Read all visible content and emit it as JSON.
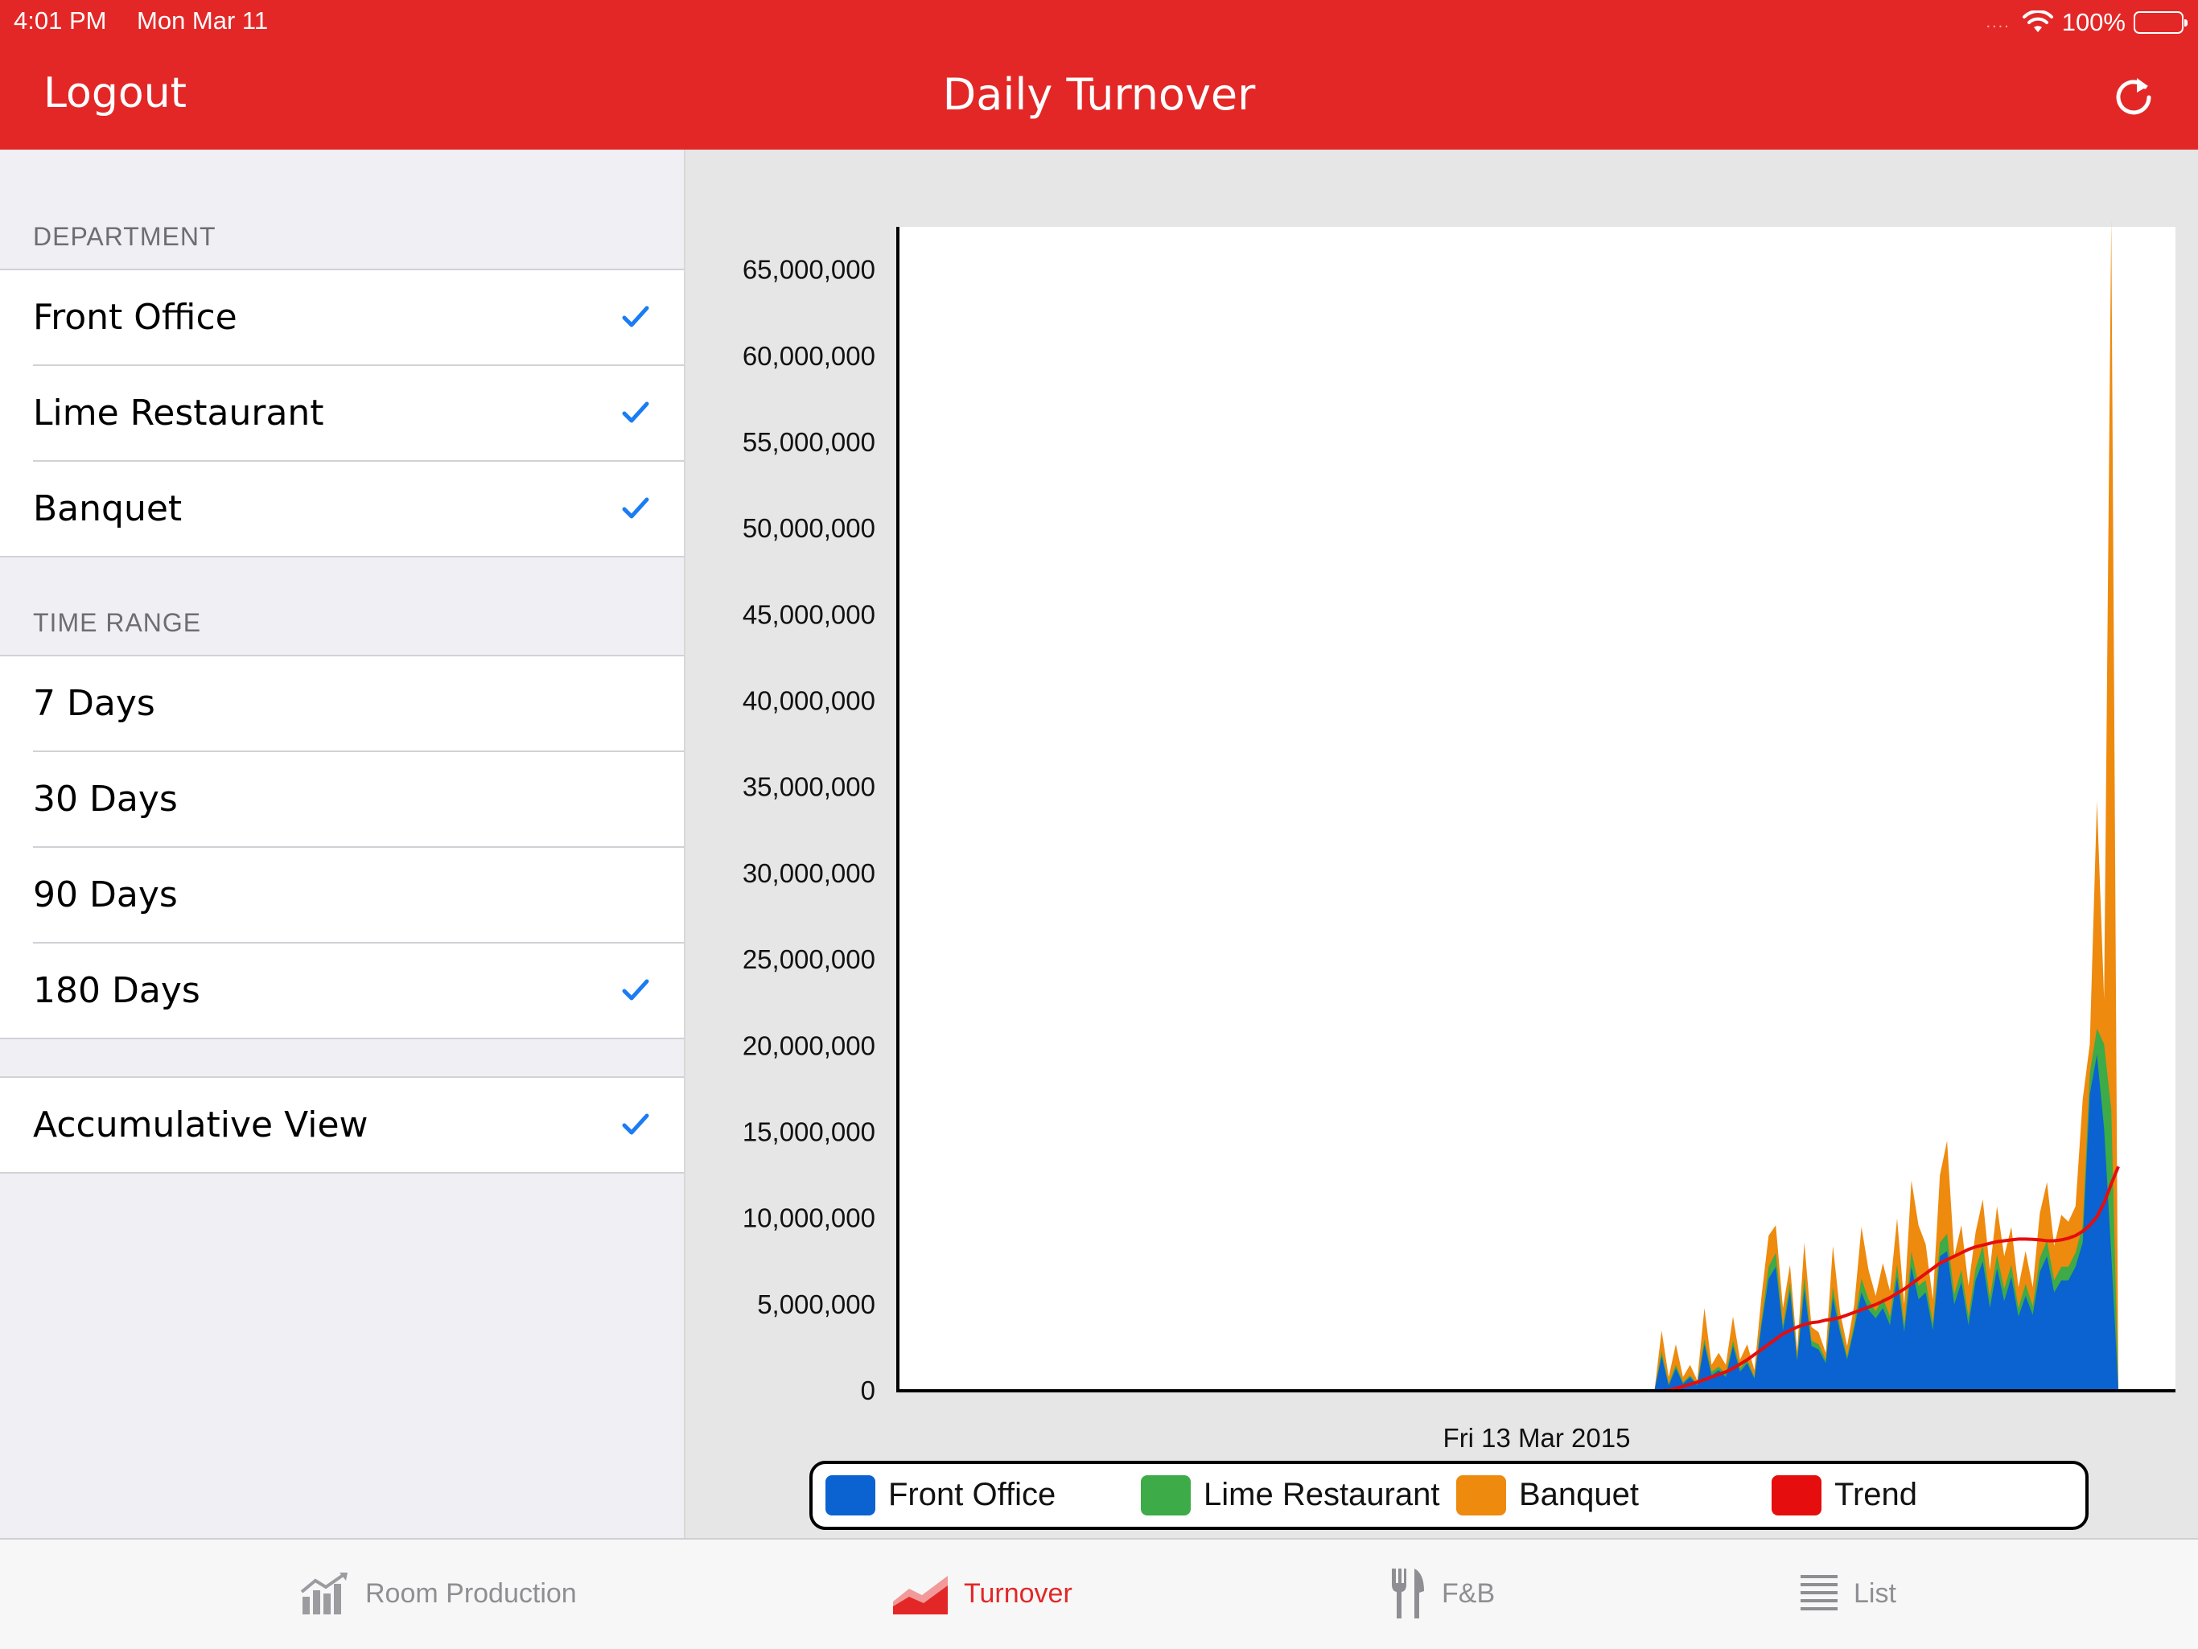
{
  "status_bar": {
    "time": "4:01 PM",
    "date": "Mon Mar 11",
    "signal_dots": "....",
    "battery": "100%"
  },
  "nav": {
    "left_button": "Logout",
    "title": "Daily Turnover",
    "refresh_icon": "refresh-icon"
  },
  "sidebar": {
    "department_header": "DEPARTMENT",
    "departments": [
      {
        "label": "Front Office",
        "checked": true
      },
      {
        "label": "Lime Restaurant",
        "checked": true
      },
      {
        "label": "Banquet",
        "checked": true
      }
    ],
    "time_range_header": "TIME RANGE",
    "time_ranges": [
      {
        "label": "7 Days",
        "checked": false
      },
      {
        "label": "30 Days",
        "checked": false
      },
      {
        "label": "90 Days",
        "checked": false
      },
      {
        "label": "180 Days",
        "checked": true
      }
    ],
    "accumulative": {
      "label": "Accumulative View",
      "checked": true
    }
  },
  "colors": {
    "accent": "#e32727",
    "check": "#1b7cf4",
    "front_office": "#0b62d1",
    "lime": "#3dab47",
    "banquet": "#ee8a0e",
    "trend": "#e50d0d"
  },
  "chart_data": {
    "type": "area",
    "stacked": true,
    "ylim": [
      0,
      67500000
    ],
    "yticks": [
      0,
      5000000,
      10000000,
      15000000,
      20000000,
      25000000,
      30000000,
      35000000,
      40000000,
      45000000,
      50000000,
      55000000,
      60000000,
      65000000
    ],
    "ytick_labels": [
      "0",
      "5,000,000",
      "10,000,000",
      "15,000,000",
      "20,000,000",
      "25,000,000",
      "30,000,000",
      "35,000,000",
      "40,000,000",
      "45,000,000",
      "50,000,000",
      "55,000,000",
      "60,000,000",
      "65,000,000"
    ],
    "xlabel": "Fri 13 Mar 2015",
    "legend_position": "bottom",
    "x_days": 180,
    "series": [
      {
        "name": "Front Office",
        "color": "#0b62d1",
        "values": [
          0,
          0,
          0,
          0,
          0,
          0,
          0,
          0,
          0,
          0,
          0,
          0,
          0,
          0,
          0,
          0,
          0,
          0,
          0,
          0,
          0,
          0,
          0,
          0,
          0,
          0,
          0,
          0,
          0,
          0,
          0,
          0,
          0,
          0,
          0,
          0,
          0,
          0,
          0,
          0,
          0,
          0,
          0,
          0,
          0,
          0,
          0,
          0,
          0,
          0,
          0,
          0,
          0,
          0,
          0,
          0,
          0,
          0,
          0,
          0,
          0,
          0,
          0,
          0,
          0,
          0,
          0,
          0,
          0,
          0,
          0,
          0,
          0,
          0,
          0,
          0,
          0,
          0,
          0,
          0,
          0,
          0,
          0,
          0,
          0,
          0,
          0,
          0,
          0,
          0,
          0,
          0,
          0,
          0,
          0,
          0,
          0,
          0,
          0,
          0,
          0,
          0,
          0,
          0,
          0,
          0,
          0,
          2000000,
          300000,
          1300000,
          400000,
          800000,
          300000,
          2700000,
          900000,
          1200000,
          800000,
          2600000,
          1100000,
          1600000,
          700000,
          3800000,
          6500000,
          7200000,
          3500000,
          5800000,
          1700000,
          5900000,
          2600000,
          2400000,
          1600000,
          5400000,
          3400000,
          1800000,
          3600000,
          5700000,
          4700000,
          4200000,
          4800000,
          3800000,
          6600000,
          3400000,
          7200000,
          5300000,
          5700000,
          3500000,
          7800000,
          8100000,
          5000000,
          6300000,
          3800000,
          6400000,
          7500000,
          4800000,
          7100000,
          5200000,
          6600000,
          4300000,
          5500000,
          4400000,
          6900000,
          7800000,
          5700000,
          6400000,
          6400000,
          7200000,
          8600000,
          17200000,
          19500000,
          15200000,
          7900000
        ]
      },
      {
        "name": "Lime Restaurant",
        "color": "#3dab47",
        "values": [
          0,
          0,
          0,
          0,
          0,
          0,
          0,
          0,
          0,
          0,
          0,
          0,
          0,
          0,
          0,
          0,
          0,
          0,
          0,
          0,
          0,
          0,
          0,
          0,
          0,
          0,
          0,
          0,
          0,
          0,
          0,
          0,
          0,
          0,
          0,
          0,
          0,
          0,
          0,
          0,
          0,
          0,
          0,
          0,
          0,
          0,
          0,
          0,
          0,
          0,
          0,
          0,
          0,
          0,
          0,
          0,
          0,
          0,
          0,
          0,
          0,
          0,
          0,
          0,
          0,
          0,
          0,
          0,
          0,
          0,
          0,
          0,
          0,
          0,
          0,
          0,
          0,
          0,
          0,
          0,
          0,
          0,
          0,
          0,
          0,
          0,
          0,
          0,
          0,
          0,
          0,
          0,
          0,
          0,
          0,
          0,
          0,
          0,
          0,
          0,
          0,
          0,
          0,
          0,
          0,
          0,
          0,
          300000,
          100000,
          200000,
          100000,
          100000,
          100000,
          300000,
          200000,
          200000,
          200000,
          300000,
          200000,
          200000,
          100000,
          300000,
          700000,
          800000,
          300000,
          500000,
          200000,
          700000,
          300000,
          300000,
          200000,
          600000,
          300000,
          200000,
          300000,
          800000,
          600000,
          400000,
          600000,
          500000,
          700000,
          400000,
          900000,
          800000,
          700000,
          400000,
          800000,
          1000000,
          600000,
          700000,
          500000,
          700000,
          900000,
          600000,
          800000,
          700000,
          700000,
          500000,
          700000,
          500000,
          800000,
          900000,
          700000,
          800000,
          800000,
          800000,
          1000000,
          1200000,
          1500000,
          4900000,
          8400000
        ]
      },
      {
        "name": "Banquet",
        "color": "#ee8a0e",
        "values": [
          0,
          0,
          0,
          0,
          0,
          0,
          0,
          0,
          0,
          0,
          0,
          0,
          0,
          0,
          0,
          0,
          0,
          0,
          0,
          0,
          0,
          0,
          0,
          0,
          0,
          0,
          0,
          0,
          0,
          0,
          0,
          0,
          0,
          0,
          0,
          0,
          0,
          0,
          0,
          0,
          0,
          0,
          0,
          0,
          0,
          0,
          0,
          0,
          0,
          0,
          0,
          0,
          0,
          0,
          0,
          0,
          0,
          0,
          0,
          0,
          0,
          0,
          0,
          0,
          0,
          0,
          0,
          0,
          0,
          0,
          0,
          0,
          0,
          0,
          0,
          0,
          0,
          0,
          0,
          0,
          0,
          0,
          0,
          0,
          0,
          0,
          0,
          0,
          0,
          0,
          0,
          0,
          0,
          0,
          0,
          0,
          0,
          0,
          0,
          0,
          0,
          0,
          0,
          0,
          0,
          0,
          0,
          1200000,
          400000,
          1200000,
          300000,
          600000,
          200000,
          1800000,
          400000,
          800000,
          500000,
          1400000,
          500000,
          900000,
          400000,
          1400000,
          1800000,
          1600000,
          1000000,
          1000000,
          400000,
          2000000,
          800000,
          700000,
          400000,
          2400000,
          900000,
          600000,
          1100000,
          3000000,
          1700000,
          900000,
          2000000,
          1500000,
          2700000,
          1200000,
          4100000,
          3500000,
          2100000,
          1400000,
          3900000,
          5400000,
          2200000,
          2600000,
          1800000,
          2100000,
          2700000,
          1600000,
          2800000,
          1900000,
          2200000,
          1200000,
          1900000,
          1100000,
          2600000,
          3400000,
          2000000,
          3000000,
          2600000,
          2700000,
          7300000,
          1700000,
          13200000,
          2600000,
          51600000
        ]
      },
      {
        "name": "Trend",
        "color": "#e50d0d",
        "type": "line",
        "values": [
          0,
          0,
          0,
          0,
          0,
          0,
          0,
          0,
          0,
          0,
          0,
          0,
          0,
          0,
          0,
          0,
          0,
          0,
          0,
          0,
          0,
          0,
          0,
          0,
          0,
          0,
          0,
          0,
          0,
          0,
          0,
          0,
          0,
          0,
          0,
          0,
          0,
          0,
          0,
          0,
          0,
          0,
          0,
          0,
          0,
          0,
          0,
          0,
          0,
          0,
          0,
          0,
          0,
          0,
          0,
          0,
          0,
          0,
          0,
          0,
          0,
          0,
          0,
          0,
          0,
          0,
          0,
          0,
          0,
          0,
          0,
          0,
          0,
          0,
          0,
          0,
          0,
          0,
          0,
          0,
          0,
          0,
          0,
          0,
          0,
          0,
          0,
          0,
          0,
          0,
          0,
          0,
          0,
          0,
          0,
          0,
          0,
          0,
          0,
          0,
          0,
          0,
          0,
          0,
          0,
          0,
          0,
          0,
          40000,
          140000,
          250000,
          380000,
          500000,
          650000,
          800000,
          950000,
          1100000,
          1300000,
          1550000,
          1800000,
          2100000,
          2400000,
          2700000,
          3000000,
          3300000,
          3500000,
          3700000,
          3850000,
          3950000,
          4000000,
          4100000,
          4150000,
          4250000,
          4400000,
          4550000,
          4700000,
          4850000,
          5000000,
          5200000,
          5400000,
          5650000,
          5900000,
          6200000,
          6500000,
          6800000,
          7100000,
          7400000,
          7600000,
          7800000,
          8000000,
          8200000,
          8350000,
          8450000,
          8550000,
          8650000,
          8700000,
          8750000,
          8800000,
          8800000,
          8780000,
          8750000,
          8700000,
          8700000,
          8750000,
          8850000,
          9000000,
          9250000,
          9600000,
          10100000,
          10900000,
          12000000,
          13000000
        ]
      }
    ]
  },
  "tabs": [
    {
      "label": "Room Production",
      "icon": "bar-chart-icon",
      "active": false
    },
    {
      "label": "Turnover",
      "icon": "area-chart-icon",
      "active": true
    },
    {
      "label": "F&B",
      "icon": "fork-knife-icon",
      "active": false
    },
    {
      "label": "List",
      "icon": "list-icon",
      "active": false
    }
  ]
}
